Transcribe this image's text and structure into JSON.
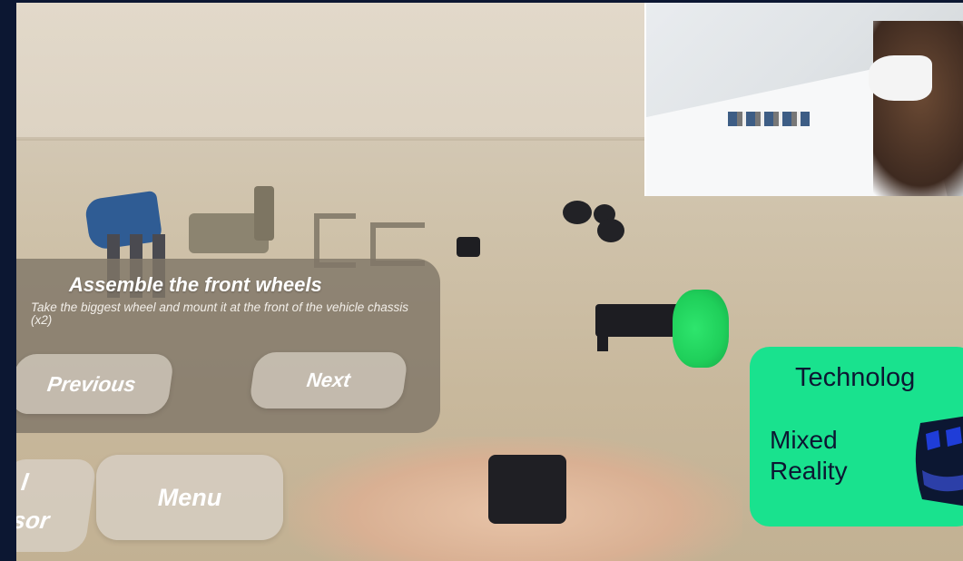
{
  "instruction_panel": {
    "title": "Assemble the front wheels",
    "description": "Take the biggest wheel and mount it at the front of the vehicle chassis (x2)",
    "previous_label": "Previous",
    "next_label": "Next"
  },
  "bottom_menu": {
    "virtual_cursor_line1": "l",
    "virtual_cursor_line2": "sor",
    "menu_label": "Menu"
  },
  "technology_card": {
    "title": "Technolog",
    "subtitle_line1": "Mixed",
    "subtitle_line2": "Reality",
    "icon": "vr-headset-icon",
    "background_color": "#19e28e",
    "text_color": "#0c1732"
  },
  "colors": {
    "frame": "#0c1732",
    "panel": "#807668",
    "hologram_wheel": "#1fcf5a"
  }
}
